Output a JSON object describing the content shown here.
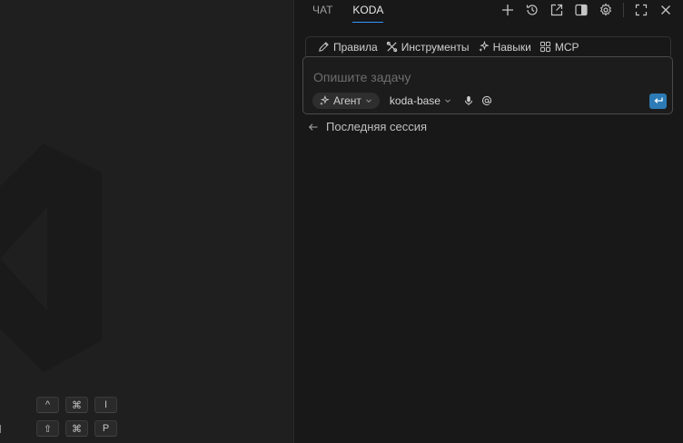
{
  "editor": {
    "watermark": "vscode-logo-watermark",
    "shortcuts": [
      {
        "keys": [
          "^",
          "⌘",
          "I"
        ]
      },
      {
        "keys": [
          "⇧",
          "⌘",
          "P"
        ]
      }
    ]
  },
  "panel": {
    "tabs": [
      {
        "label": "ЧАТ",
        "active": false
      },
      {
        "label": "KODA",
        "active": true
      }
    ],
    "toolbar_icons": [
      "plus-icon",
      "history-icon",
      "open-external-icon",
      "split-panel-icon",
      "gear-icon",
      "maximize-icon",
      "close-icon"
    ],
    "features": [
      {
        "label": "Правила",
        "icon": "pencil-icon"
      },
      {
        "label": "Инструменты",
        "icon": "tools-icon"
      },
      {
        "label": "Навыки",
        "icon": "sparkle-icon"
      },
      {
        "label": "MCP",
        "icon": "grid-icon"
      }
    ],
    "input": {
      "placeholder": "Опишите задачу",
      "mode": "Агент",
      "model": "koda-base"
    },
    "last_session": "Последняя сессия"
  },
  "colors": {
    "accent": "#3794ff",
    "send_button": "#2c7bb6"
  }
}
